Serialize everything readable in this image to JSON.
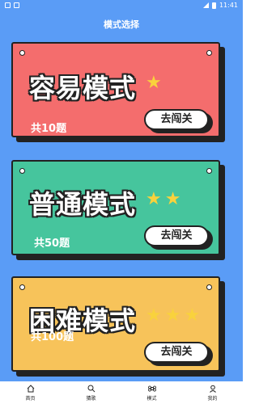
{
  "status_bar": {
    "time": "11:41"
  },
  "header": {
    "title": "模式选择"
  },
  "modes": [
    {
      "title": "容易模式",
      "count": "共10题",
      "button": "去闯关",
      "stars": 1,
      "color": "#f46d6d"
    },
    {
      "title": "普通模式",
      "count": "共50题",
      "button": "去闯关",
      "stars": 2,
      "color": "#46c59d"
    },
    {
      "title": "困难模式",
      "count": "共100题",
      "button": "去闯关",
      "stars": 3,
      "color": "#f7c35a"
    }
  ],
  "tabbar": {
    "items": [
      {
        "label": "首页",
        "icon": "home-icon"
      },
      {
        "label": "猜歌",
        "icon": "search-music-icon"
      },
      {
        "label": "模式",
        "icon": "command-icon"
      },
      {
        "label": "我的",
        "icon": "user-icon"
      }
    ]
  }
}
